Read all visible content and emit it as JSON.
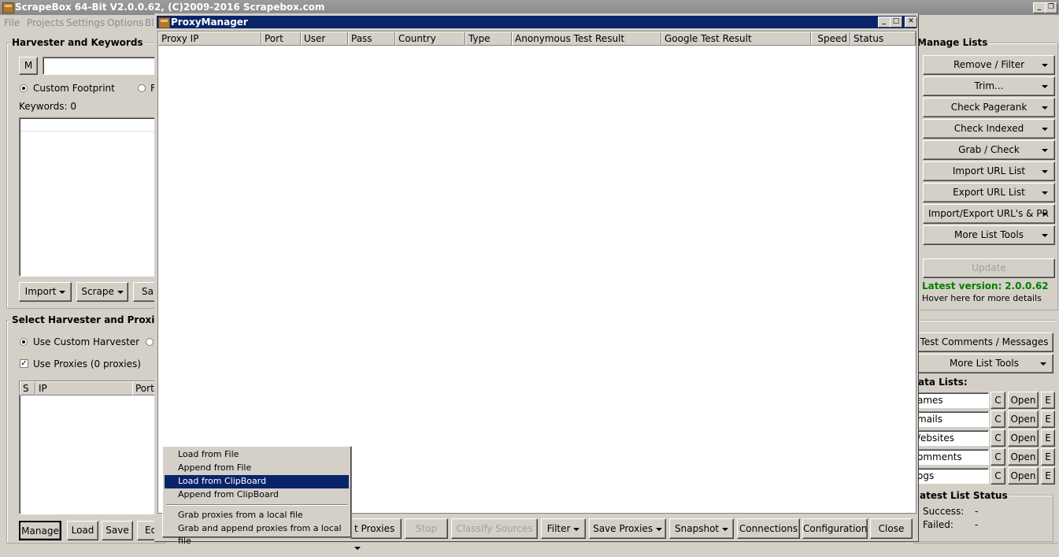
{
  "app": {
    "title": "ScrapeBox 64-Bit V2.0.0.62, (C)2009-2016 Scrapebox.com"
  },
  "menu": [
    "File",
    "Projects",
    "Settings",
    "Options",
    "Bl"
  ],
  "harvester": {
    "title": "Harvester and Keywords",
    "m_button": "M",
    "radio_custom": "Custom Footprint",
    "radio_other": "F",
    "keywords_label": "Keywords:",
    "keywords_count": "0",
    "import": "Import",
    "scrape": "Scrape",
    "save": "Sa"
  },
  "select_harvester": {
    "title": "Select Harvester and Proxies",
    "use_custom": "Use Custom Harvester",
    "use_proxies": "Use Proxies",
    "proxies_count": "(0 proxies)",
    "cols": [
      "S",
      "IP",
      "Port"
    ],
    "buttons": [
      "Manage",
      "Load",
      "Save",
      "Ed"
    ]
  },
  "manage_lists": {
    "title": "Manage Lists",
    "buttons": [
      "Remove / Filter",
      "Trim...",
      "Check Pagerank",
      "Check Indexed",
      "Grab / Check",
      "Import URL List",
      "Export URL List",
      "Import/Export URL's & PR",
      "More List Tools"
    ],
    "update": "Update",
    "latest_label": "Latest version:",
    "latest_value": "2.0.0.62",
    "hover": "Hover here for more details"
  },
  "comments": {
    "test": "Test Comments / Messages",
    "more": "More List Tools",
    "data_lists_title": "ata Lists:",
    "lists": [
      {
        "name": "ames",
        "c": "C",
        "open": "Open",
        "e": "E"
      },
      {
        "name": "mails",
        "c": "C",
        "open": "Open",
        "e": "E"
      },
      {
        "name": "/ebsites",
        "c": "C",
        "open": "Open",
        "e": "E"
      },
      {
        "name": "omments",
        "c": "C",
        "open": "Open",
        "e": "E"
      },
      {
        "name": "ogs",
        "c": "C",
        "open": "Open",
        "e": "E"
      }
    ],
    "status_title": "atest List Status",
    "success_label": "Success:",
    "success_value": "-",
    "failed_label": "Failed:",
    "failed_value": "-"
  },
  "proxy_manager": {
    "title": "ProxyManager",
    "columns": [
      "Proxy IP",
      "Port",
      "User",
      "Pass",
      "Country",
      "Type",
      "Anonymous Test Result",
      "Google Test Result",
      "Speed",
      "Status"
    ],
    "bottom": {
      "load_proxies": "t Proxies",
      "stop": "Stop",
      "classify": "Classify Sources",
      "filter": "Filter",
      "save_proxies": "Save Proxies",
      "snapshot": "Snapshot",
      "connections": "Connections",
      "configuration": "Configuration",
      "close": "Close"
    },
    "context_menu": [
      "Load from File",
      "Append from File",
      "Load from ClipBoard",
      "Append from ClipBoard",
      "Grab proxies from a local file",
      "Grab and append proxies from a local file"
    ],
    "selected_item": "Load from ClipBoard"
  }
}
